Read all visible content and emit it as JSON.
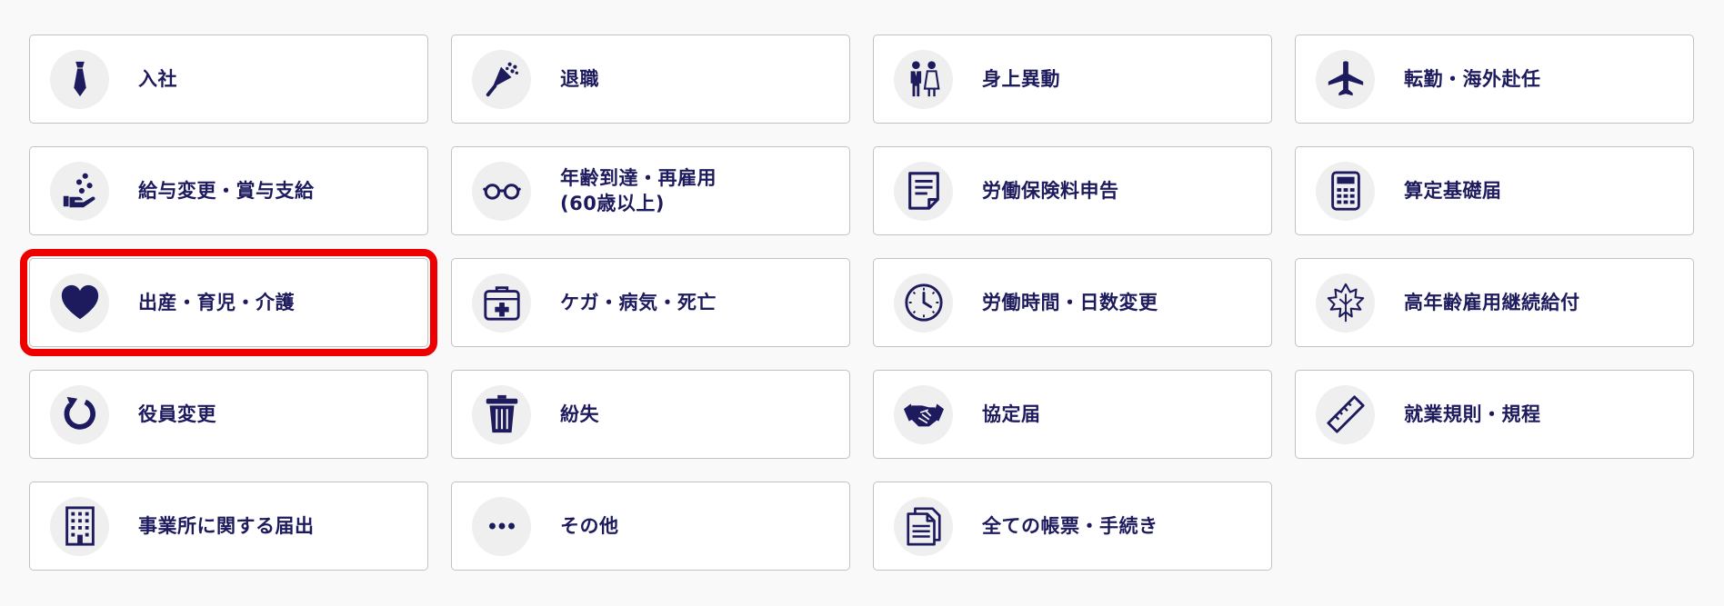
{
  "accent_color": "#1d1b5e",
  "highlight_color": "#ee0000",
  "items": [
    {
      "label": "入社",
      "icon": "necktie-icon",
      "name": "card-nyusha"
    },
    {
      "label": "退職",
      "icon": "bouquet-icon",
      "name": "card-taishoku"
    },
    {
      "label": "身上異動",
      "icon": "wedding-couple-icon",
      "name": "card-shinjo-ido"
    },
    {
      "label": "転勤・海外赴任",
      "icon": "airplane-icon",
      "name": "card-tenkin"
    },
    {
      "label": "給与変更・賞与支給",
      "icon": "coins-hand-icon",
      "name": "card-kyuyo-henko"
    },
    {
      "label": "年齢到達・再雇用\n(60歳以上)",
      "icon": "glasses-icon",
      "name": "card-nenrei-toutatsu"
    },
    {
      "label": "労働保険料申告",
      "icon": "document-icon",
      "name": "card-rodo-hokenryo"
    },
    {
      "label": "算定基礎届",
      "icon": "calculator-icon",
      "name": "card-santei-kiso"
    },
    {
      "label": "出産・育児・介護",
      "icon": "heart-icon",
      "name": "card-shussan-ikuji",
      "highlighted": true
    },
    {
      "label": "ケガ・病気・死亡",
      "icon": "first-aid-kit-icon",
      "name": "card-kega-byoki"
    },
    {
      "label": "労働時間・日数変更",
      "icon": "clock-icon",
      "name": "card-rodo-jikan"
    },
    {
      "label": "高年齢雇用継続給付",
      "icon": "maple-leaf-icon",
      "name": "card-konenrei-koyo"
    },
    {
      "label": "役員変更",
      "icon": "refresh-icon",
      "name": "card-yakuin-henko"
    },
    {
      "label": "紛失",
      "icon": "trash-icon",
      "name": "card-funshitsu"
    },
    {
      "label": "協定届",
      "icon": "handshake-icon",
      "name": "card-kyotei-todoke"
    },
    {
      "label": "就業規則・規程",
      "icon": "ruler-icon",
      "name": "card-shugyo-kisoku"
    },
    {
      "label": "事業所に関する届出",
      "icon": "building-icon",
      "name": "card-jigyosho"
    },
    {
      "label": "その他",
      "icon": "ellipsis-icon",
      "name": "card-sonota"
    },
    {
      "label": "全ての帳票・手続き",
      "icon": "documents-icon",
      "name": "card-subete"
    }
  ]
}
